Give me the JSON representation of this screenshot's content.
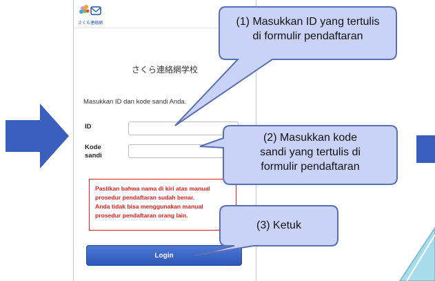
{
  "logo": {
    "caption": "さくら連絡網"
  },
  "login": {
    "school_name": "さくら連絡網学校",
    "instruction": "Masukkan ID dan kode sandi Anda.",
    "id_label": "ID",
    "password_label_line1": "Kode",
    "password_label_line2": "sandi",
    "id_value": "",
    "password_value": "",
    "warning_line1": "Pastikan bahwa nama di kiri atas manual",
    "warning_line2": "prosedur pendaftaran sudah benar.",
    "warning_line3": "Anda tidak bisa menggunakan manual",
    "warning_line4": "prosedur pendaftaran orang lain.",
    "login_button": "Login"
  },
  "callouts": {
    "c1_line1": "(1) Masukkan ID yang tertulis",
    "c1_line2": "di formulir pendaftaran",
    "c2_line1": "(2) Masukkan kode",
    "c2_line2": "sandi yang tertulis di",
    "c2_line3": "formulir pendaftaran",
    "c3": "(3) Ketuk"
  },
  "colors": {
    "arrow": "#3b5fbd",
    "callout_fill": "#c9d2f7",
    "callout_border": "#5a6fb3",
    "warning": "#e21d1d",
    "button": "#3b65c6",
    "teal_decor": "#9ed6e6"
  }
}
